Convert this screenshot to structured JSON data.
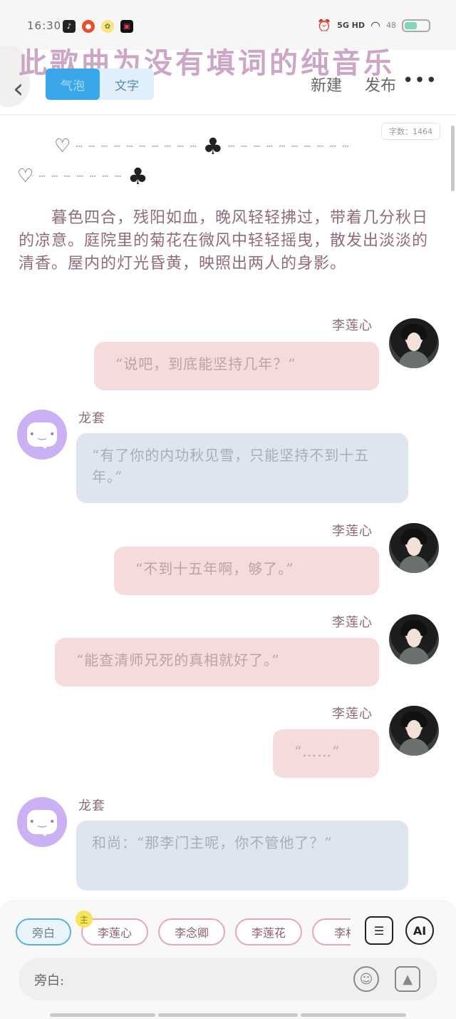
{
  "status_bar": {
    "time": "16:30",
    "network": "5G HD",
    "battery": "48"
  },
  "banner_text": "此歌曲为没有填词的纯音乐",
  "nav": {
    "tabs": [
      {
        "label": "气泡",
        "active": true
      },
      {
        "label": "文字",
        "active": false
      }
    ],
    "new_label": "新建",
    "publish_label": "发布",
    "more_label": "•••"
  },
  "word_count": "字数：1464",
  "separators": {
    "line1": {
      "heart": "♡",
      "dots": "┄ ┄ ┄ ┄ ┄ ┄ ┄ ┄ ┄ ┄",
      "club": "♣",
      "dots_after": "┄ ┄ ┄ ┄ ┄ ┄ ┄ ┄ ┄ ┄"
    },
    "line2": {
      "heart": "♡",
      "dots": "┄ ┄ ┄ ┄ ┄ ┄ ┄",
      "club": "♣"
    }
  },
  "narration": "　　暮色四合，残阳如血，晚风轻轻拂过，带着几分秋日的凉意。庭院里的菊花在微风中轻轻摇曳，散发出淡淡的清香。屋内的灯光昏黄，映照出两人的身影。",
  "messages": [
    {
      "sender": "李莲心",
      "text": "“说吧，到底能坚持几年？”"
    },
    {
      "sender": "龙套",
      "text": "“有了你的内功秋见雪，只能坚持不到十五年。”"
    },
    {
      "sender": "李莲心",
      "text": "“不到十五年啊，够了。”"
    },
    {
      "sender": "李莲心",
      "text": "“能查清师兄死的真相就好了。”"
    },
    {
      "sender": "李莲心",
      "text": "“……”"
    },
    {
      "sender": "龙套",
      "text": "和尚：“那李门主呢，你不管他了？”"
    }
  ],
  "roles": {
    "chips": [
      "旁白",
      "李莲心",
      "李念卿",
      "李莲花",
      "李相"
    ],
    "main_badge": "主",
    "active": "旁白"
  },
  "tools": {
    "role_icon": "role-card-icon",
    "ai_label": "AI"
  },
  "input": {
    "prefix": "旁白:",
    "emoji_icon": "smiley-icon",
    "image_icon": "image-icon"
  },
  "colors": {
    "accent": "#3aa7ea",
    "pink_bubble": "#f6dbdc",
    "blue_bubble": "#dfe5ef",
    "bot_avatar": "#cbb1f3"
  }
}
